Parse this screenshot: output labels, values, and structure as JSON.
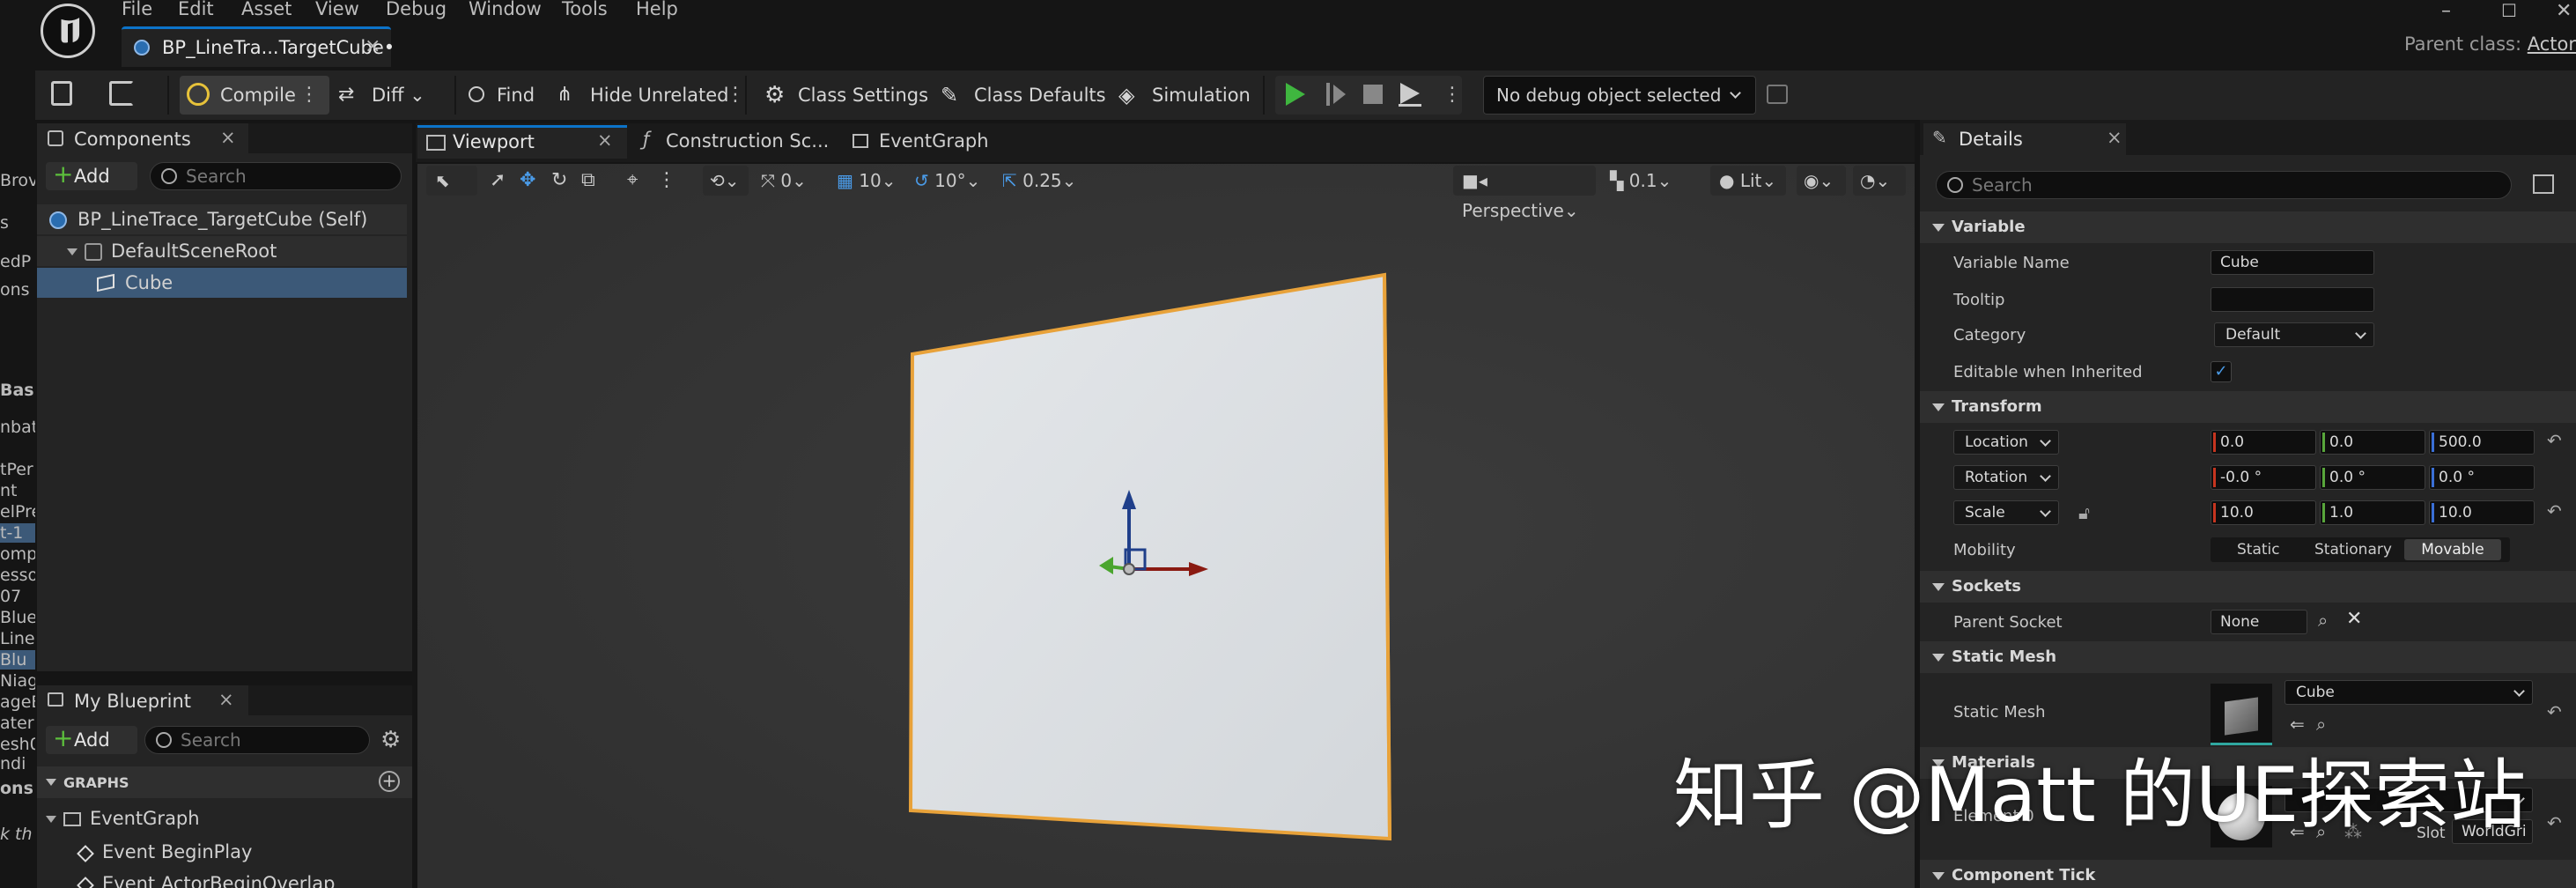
{
  "menu": [
    "File",
    "Edit",
    "Asset",
    "View",
    "Debug",
    "Window",
    "Tools",
    "Help"
  ],
  "doc_tab": {
    "title": "BP_LineTra...TargetCube•",
    "close": "×"
  },
  "parent_class": {
    "label": "Parent class:",
    "value": "Actor"
  },
  "window_controls": [
    "–",
    "☐",
    "✕"
  ],
  "toolbar": {
    "compile": "Compile",
    "diff": "Diff",
    "find": "Find",
    "hide_unrelated": "Hide Unrelated",
    "class_settings": "Class Settings",
    "class_defaults": "Class Defaults",
    "simulation": "Simulation",
    "debug_object": "No debug object selected"
  },
  "left_strip": [
    "Brov",
    "s",
    "edP",
    "ons",
    "Basi",
    "nbat",
    "tPer",
    "nt",
    "elPre",
    "t-1",
    "omp",
    "esso",
    "07",
    "Blue",
    "Line",
    "Blu",
    "Niag",
    "ageE",
    "ater",
    "esh0",
    "ndi",
    "ons",
    "k th"
  ],
  "components": {
    "tab": "Components",
    "close": "×",
    "add": "Add",
    "search_placeholder": "Search",
    "items": [
      "BP_LineTrace_TargetCube (Self)",
      "DefaultSceneRoot",
      "Cube"
    ]
  },
  "my_blueprint": {
    "tab": "My Blueprint",
    "close": "×",
    "add": "Add",
    "search_placeholder": "Search",
    "graphs_header": "GRAPHS",
    "event_graph": "EventGraph",
    "events": [
      "Event BeginPlay",
      "Event ActorBeginOverlap"
    ]
  },
  "editor_tabs": {
    "viewport": "Viewport",
    "construction": "Construction Sc...",
    "eventgraph": "EventGraph",
    "close": "×"
  },
  "viewport_toolbar": {
    "rotate_snap": "0",
    "grid": "10",
    "angle": "10°",
    "scale": "0.25",
    "perspective": "Perspective",
    "camera_speed": "0.1",
    "lit": "Lit"
  },
  "details": {
    "tab": "Details",
    "close": "×",
    "search_placeholder": "Search",
    "sections": {
      "variable": "Variable",
      "transform": "Transform",
      "sockets": "Sockets",
      "static_mesh": "Static Mesh",
      "materials": "Materials",
      "component_tick": "Component Tick"
    },
    "variable_name_label": "Variable Name",
    "variable_name": "Cube",
    "tooltip_label": "Tooltip",
    "tooltip": "",
    "category_label": "Category",
    "category": "Default",
    "editable_label": "Editable when Inherited",
    "editable": true,
    "location_label": "Location",
    "location": [
      "0.0",
      "0.0",
      "500.0"
    ],
    "rotation_label": "Rotation",
    "rotation": [
      "-0.0 °",
      "0.0 °",
      "0.0 °"
    ],
    "scale_label": "Scale",
    "scale": [
      "10.0",
      "1.0",
      "10.0"
    ],
    "mobility_label": "Mobility",
    "mobility": [
      "Static",
      "Stationary",
      "Movable"
    ],
    "mobility_selected": "Movable",
    "parent_socket_label": "Parent Socket",
    "parent_socket": "None",
    "static_mesh_label": "Static Mesh",
    "static_mesh": "Cube",
    "element0_label": "Element 0",
    "slot_label": "Slot",
    "slot_value": "WorldGri"
  },
  "watermark": "知乎 @Matt 的UE探索站",
  "colors": {
    "accent_blue": "#0c73c8",
    "selection": "#3c5978",
    "play_green": "#3fb63f",
    "plane_outline": "#e8a23a"
  }
}
